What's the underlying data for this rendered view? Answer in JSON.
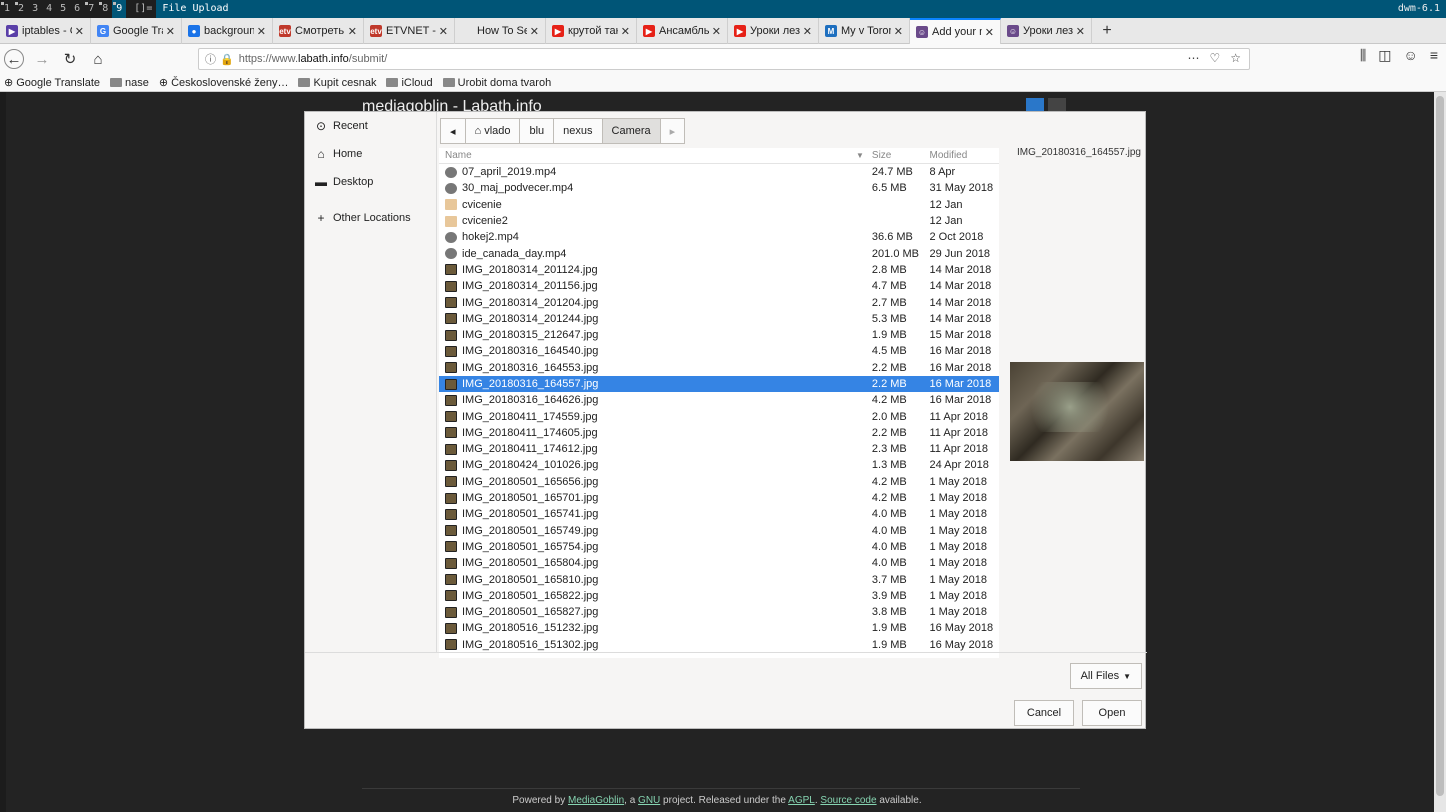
{
  "wm": {
    "workspaces": [
      {
        "label": "1",
        "occupied": true,
        "active": false
      },
      {
        "label": "2",
        "occupied": true,
        "active": false
      },
      {
        "label": "3",
        "occupied": false,
        "active": false
      },
      {
        "label": "4",
        "occupied": false,
        "active": false
      },
      {
        "label": "5",
        "occupied": false,
        "active": false
      },
      {
        "label": "6",
        "occupied": false,
        "active": false
      },
      {
        "label": "7",
        "occupied": true,
        "active": false
      },
      {
        "label": "8",
        "occupied": true,
        "active": false
      },
      {
        "label": "9",
        "occupied": true,
        "active": true
      }
    ],
    "layout": "[]=",
    "window_title": "File Upload",
    "status": "dwm-6.1"
  },
  "tabs": [
    {
      "label": "iptables - Gentoo",
      "color": "#5a3fa8",
      "glyph": "▶",
      "selected": false
    },
    {
      "label": "Google Translate",
      "color": "#4285f4",
      "glyph": "G",
      "selected": false
    },
    {
      "label": "background-image",
      "color": "#1a73e8",
      "glyph": "●",
      "selected": false
    },
    {
      "label": "Смотреть \"Шаманы\"",
      "color": "#c0392b",
      "glyph": "etv",
      "selected": false
    },
    {
      "label": "ETVNET - Прямой",
      "color": "#c0392b",
      "glyph": "etv",
      "selected": false
    },
    {
      "label": "How To Setup a Fire",
      "color": "",
      "glyph": "",
      "selected": false
    },
    {
      "label": "крутой танец жо",
      "color": "#e62117",
      "glyph": "▶",
      "selected": false
    },
    {
      "label": "Ансамбль \"Черк",
      "color": "#e62117",
      "glyph": "▶",
      "selected": false
    },
    {
      "label": "Уроки лезгинки",
      "color": "#e62117",
      "glyph": "▶",
      "selected": false
    },
    {
      "label": "My v Toronte | Н",
      "color": "#1e6fbf",
      "glyph": "M",
      "selected": false
    },
    {
      "label": "Add your media",
      "color": "#6a4a8a",
      "glyph": "☺",
      "selected": true
    },
    {
      "label": "Уроки лезгинки",
      "color": "#6a4a8a",
      "glyph": "☺",
      "selected": false
    }
  ],
  "nav": {
    "url_prefix": "https://www.",
    "url_host": "labath.info",
    "url_path": "/submit/"
  },
  "bookmarks": [
    {
      "label": "Google Translate",
      "icon": "globe"
    },
    {
      "label": "nase",
      "icon": "folder"
    },
    {
      "label": "Československé ženy…",
      "icon": "globe"
    },
    {
      "label": "Kupit cesnak",
      "icon": "folder"
    },
    {
      "label": "iCloud",
      "icon": "folder"
    },
    {
      "label": "Urobit doma tvaroh",
      "icon": "folder"
    }
  ],
  "site": {
    "header": "mediagoblin - Labath.info",
    "footer": {
      "pre": "Powered by ",
      "link1": "MediaGoblin",
      "mid1": ", a ",
      "link2": "GNU",
      "mid2": " project. Released under the ",
      "link3": "AGPL",
      "mid3": ". ",
      "link4": "Source code",
      "post": " available."
    }
  },
  "dialog": {
    "places": [
      {
        "label": "Recent",
        "icon": "⊙"
      },
      {
        "label": "Home",
        "icon": "⌂"
      },
      {
        "label": "Desktop",
        "icon": "▬"
      },
      {
        "label": "Other Locations",
        "icon": "+"
      }
    ],
    "path": [
      {
        "label": "vlado",
        "home": true,
        "current": false
      },
      {
        "label": "blu",
        "home": false,
        "current": false
      },
      {
        "label": "nexus",
        "home": false,
        "current": false
      },
      {
        "label": "Camera",
        "home": false,
        "current": true
      }
    ],
    "columns": {
      "name": "Name",
      "size": "Size",
      "modified": "Modified"
    },
    "files": [
      {
        "name": "07_april_2019.mp4",
        "type": "video",
        "size": "24.7 MB",
        "modified": "8 Apr"
      },
      {
        "name": "30_maj_podvecer.mp4",
        "type": "video",
        "size": "6.5 MB",
        "modified": "31 May 2018"
      },
      {
        "name": "cvicenie",
        "type": "folder",
        "size": "",
        "modified": "12 Jan"
      },
      {
        "name": "cvicenie2",
        "type": "folder",
        "size": "",
        "modified": "12 Jan"
      },
      {
        "name": "hokej2.mp4",
        "type": "video",
        "size": "36.6 MB",
        "modified": "2 Oct 2018"
      },
      {
        "name": "ide_canada_day.mp4",
        "type": "video",
        "size": "201.0 MB",
        "modified": "29 Jun 2018"
      },
      {
        "name": "IMG_20180314_201124.jpg",
        "type": "image",
        "size": "2.8 MB",
        "modified": "14 Mar 2018"
      },
      {
        "name": "IMG_20180314_201156.jpg",
        "type": "image",
        "size": "4.7 MB",
        "modified": "14 Mar 2018"
      },
      {
        "name": "IMG_20180314_201204.jpg",
        "type": "image",
        "size": "2.7 MB",
        "modified": "14 Mar 2018"
      },
      {
        "name": "IMG_20180314_201244.jpg",
        "type": "image",
        "size": "5.3 MB",
        "modified": "14 Mar 2018"
      },
      {
        "name": "IMG_20180315_212647.jpg",
        "type": "image",
        "size": "1.9 MB",
        "modified": "15 Mar 2018"
      },
      {
        "name": "IMG_20180316_164540.jpg",
        "type": "image",
        "size": "4.5 MB",
        "modified": "16 Mar 2018"
      },
      {
        "name": "IMG_20180316_164553.jpg",
        "type": "image",
        "size": "2.2 MB",
        "modified": "16 Mar 2018"
      },
      {
        "name": "IMG_20180316_164557.jpg",
        "type": "image",
        "size": "2.2 MB",
        "modified": "16 Mar 2018",
        "selected": true
      },
      {
        "name": "IMG_20180316_164626.jpg",
        "type": "image",
        "size": "4.2 MB",
        "modified": "16 Mar 2018"
      },
      {
        "name": "IMG_20180411_174559.jpg",
        "type": "image",
        "size": "2.0 MB",
        "modified": "11 Apr 2018"
      },
      {
        "name": "IMG_20180411_174605.jpg",
        "type": "image",
        "size": "2.2 MB",
        "modified": "11 Apr 2018"
      },
      {
        "name": "IMG_20180411_174612.jpg",
        "type": "image",
        "size": "2.3 MB",
        "modified": "11 Apr 2018"
      },
      {
        "name": "IMG_20180424_101026.jpg",
        "type": "image",
        "size": "1.3 MB",
        "modified": "24 Apr 2018"
      },
      {
        "name": "IMG_20180501_165656.jpg",
        "type": "image",
        "size": "4.2 MB",
        "modified": "1 May 2018"
      },
      {
        "name": "IMG_20180501_165701.jpg",
        "type": "image",
        "size": "4.2 MB",
        "modified": "1 May 2018"
      },
      {
        "name": "IMG_20180501_165741.jpg",
        "type": "image",
        "size": "4.0 MB",
        "modified": "1 May 2018"
      },
      {
        "name": "IMG_20180501_165749.jpg",
        "type": "image",
        "size": "4.0 MB",
        "modified": "1 May 2018"
      },
      {
        "name": "IMG_20180501_165754.jpg",
        "type": "image",
        "size": "4.0 MB",
        "modified": "1 May 2018"
      },
      {
        "name": "IMG_20180501_165804.jpg",
        "type": "image",
        "size": "4.0 MB",
        "modified": "1 May 2018"
      },
      {
        "name": "IMG_20180501_165810.jpg",
        "type": "image",
        "size": "3.7 MB",
        "modified": "1 May 2018"
      },
      {
        "name": "IMG_20180501_165822.jpg",
        "type": "image",
        "size": "3.9 MB",
        "modified": "1 May 2018"
      },
      {
        "name": "IMG_20180501_165827.jpg",
        "type": "image",
        "size": "3.8 MB",
        "modified": "1 May 2018"
      },
      {
        "name": "IMG_20180516_151232.jpg",
        "type": "image",
        "size": "1.9 MB",
        "modified": "16 May 2018"
      },
      {
        "name": "IMG_20180516_151302.jpg",
        "type": "image",
        "size": "1.9 MB",
        "modified": "16 May 2018"
      }
    ],
    "preview_name": "IMG_20180316_164557.jpg",
    "filter_label": "All Files",
    "cancel_label": "Cancel",
    "open_label": "Open"
  }
}
